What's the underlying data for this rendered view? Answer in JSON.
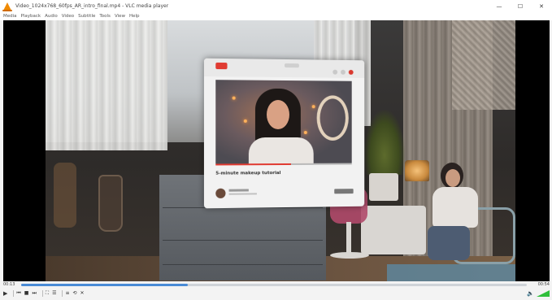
{
  "window": {
    "title": "Video_1024x768_60fps_AR_intro_final.mp4 - VLC media player",
    "controls": {
      "minimize": "—",
      "maximize": "☐",
      "close": "✕"
    }
  },
  "menu": [
    {
      "label": "Media"
    },
    {
      "label": "Playback"
    },
    {
      "label": "Audio"
    },
    {
      "label": "Video"
    },
    {
      "label": "Subtitle"
    },
    {
      "label": "Tools"
    },
    {
      "label": "View"
    },
    {
      "label": "Help"
    }
  ],
  "video": {
    "ar_card": {
      "video_title": "5-minute makeup tutorial",
      "video_progress": 0.55
    }
  },
  "seek": {
    "elapsed": "00:13",
    "total": "00:54",
    "progress": 0.33
  },
  "controls": {
    "play_icon": "play-icon",
    "prev_icon": "previous-icon",
    "stop_icon": "stop-icon",
    "next_icon": "next-icon",
    "fullscreen_icon": "fullscreen-icon",
    "ext_settings_icon": "extended-settings-icon",
    "playlist_icon": "playlist-icon",
    "loop_icon": "loop-icon",
    "shuffle_icon": "shuffle-icon",
    "volume": 0.8
  },
  "colors": {
    "accent": "#4a8bd6",
    "volume": "#2fbf3a",
    "brand": "#f08a00",
    "ar_red": "#e03b32"
  }
}
